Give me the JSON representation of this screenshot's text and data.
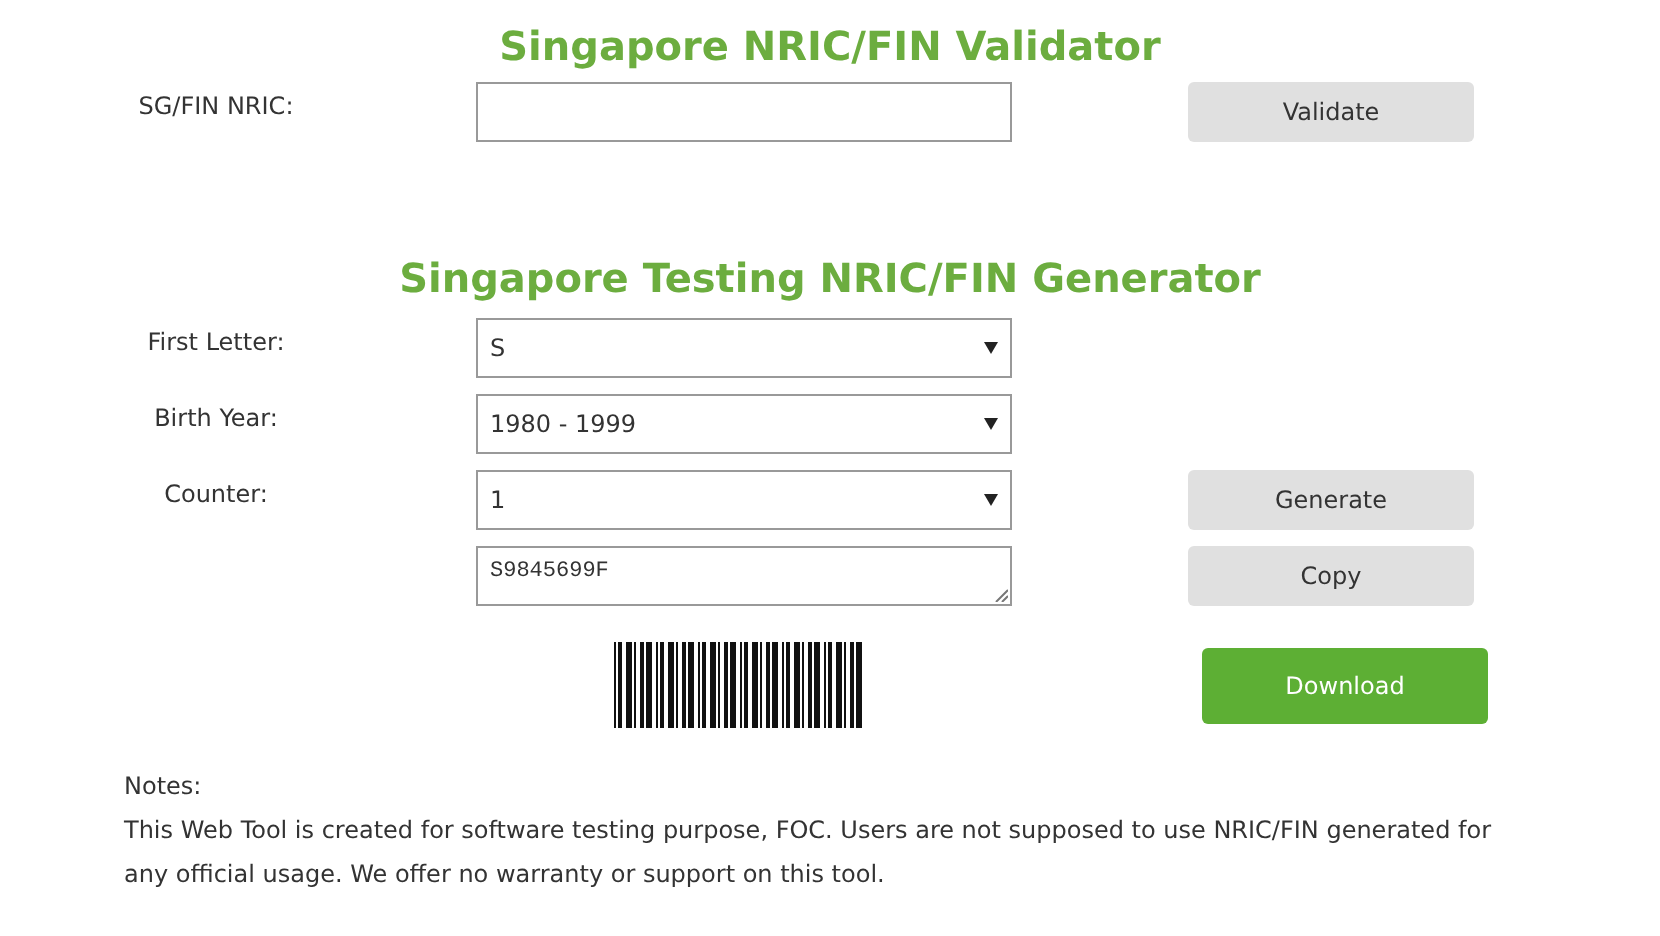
{
  "validator": {
    "title": "Singapore NRIC/FIN Validator",
    "field_label": "SG/FIN NRIC:",
    "button": "Validate"
  },
  "generator": {
    "title": "Singapore Testing NRIC/FIN Generator",
    "dropdowns": [
      {
        "label": "First Letter:",
        "value": "S"
      },
      {
        "label": "Birth Year:",
        "value": "1980 - 1999"
      },
      {
        "label": "Counter:",
        "value": "1"
      }
    ],
    "generate_button": "Generate",
    "output": "S9845699F",
    "copy_button": "Copy",
    "download_button": "Download"
  },
  "notes": {
    "heading": "Notes:",
    "text": "This Web Tool is created for software testing purpose, FOC. Users are not supposed to use NRIC/FIN generated for any official usage. We offer no warranty or support on this tool."
  }
}
